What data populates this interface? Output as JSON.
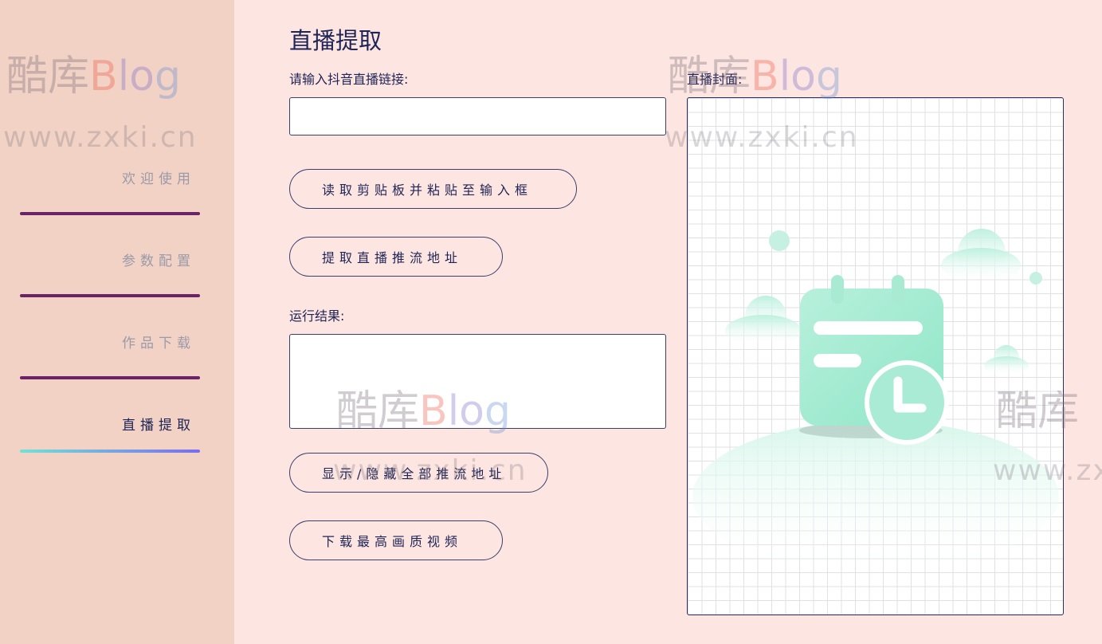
{
  "sidebar": {
    "items": [
      {
        "label": "欢迎使用",
        "active": false
      },
      {
        "label": "参数配置",
        "active": false
      },
      {
        "label": "作品下载",
        "active": false
      },
      {
        "label": "直播提取",
        "active": true
      }
    ]
  },
  "main": {
    "title": "直播提取",
    "link_label": "请输入抖音直播链接:",
    "link_value": "",
    "paste_button": "读取剪贴板并粘贴至输入框",
    "extract_button": "提取直播推流地址",
    "result_label": "运行结果:",
    "result_value": "",
    "toggle_button": "显示/隐藏全部推流地址",
    "download_button": "下载最高画质视频",
    "cover_label": "直播封面:",
    "cover_icon": "calendar-clock-illustration"
  },
  "watermark": {
    "brand_cn": "酷库",
    "brand_b": "B",
    "brand_l": "l",
    "brand_o": "o",
    "brand_g": "g",
    "url": "www.zxki.cn"
  },
  "colors": {
    "accent_bar": "#6b2368",
    "active_gradient_start": "#6fe3d5",
    "active_gradient_end": "#7b6cf0",
    "text": "#1f2456"
  }
}
